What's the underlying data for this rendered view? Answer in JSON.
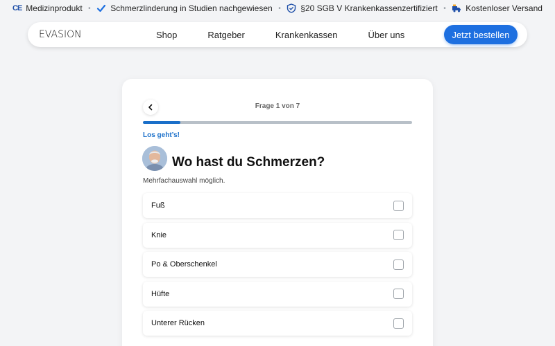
{
  "trustbar": {
    "items": [
      {
        "icon": "ce-mark-icon",
        "mark": "CE",
        "label": "Medizinprodukt"
      },
      {
        "icon": "checkmark-icon",
        "label": "Schmerzlinderung in Studien nachgewiesen"
      },
      {
        "icon": "shield-check-icon",
        "label": "§20 SGB V Krankenkassenzertifiziert"
      },
      {
        "icon": "delivery-truck-icon",
        "label": "Kostenloser Versand"
      }
    ],
    "separator": "•"
  },
  "nav": {
    "logo": "EVASION",
    "links": [
      "Shop",
      "Ratgeber",
      "Krankenkassen",
      "Über uns"
    ],
    "cta": "Jetzt bestellen"
  },
  "quiz": {
    "step_label": "Frage 1 von 7",
    "progress": 0.14,
    "eyebrow": "Los geht’s!",
    "question": "Wo hast du Schmerzen?",
    "hint": "Mehrfachauswahl möglich.",
    "options": [
      "Fuß",
      "Knie",
      "Po & Oberschenkel",
      "Hüfte",
      "Unterer Rücken"
    ]
  },
  "colors": {
    "accent": "#1a6fc9",
    "button": "#1d6fe0",
    "background": "#f3f4f6"
  }
}
